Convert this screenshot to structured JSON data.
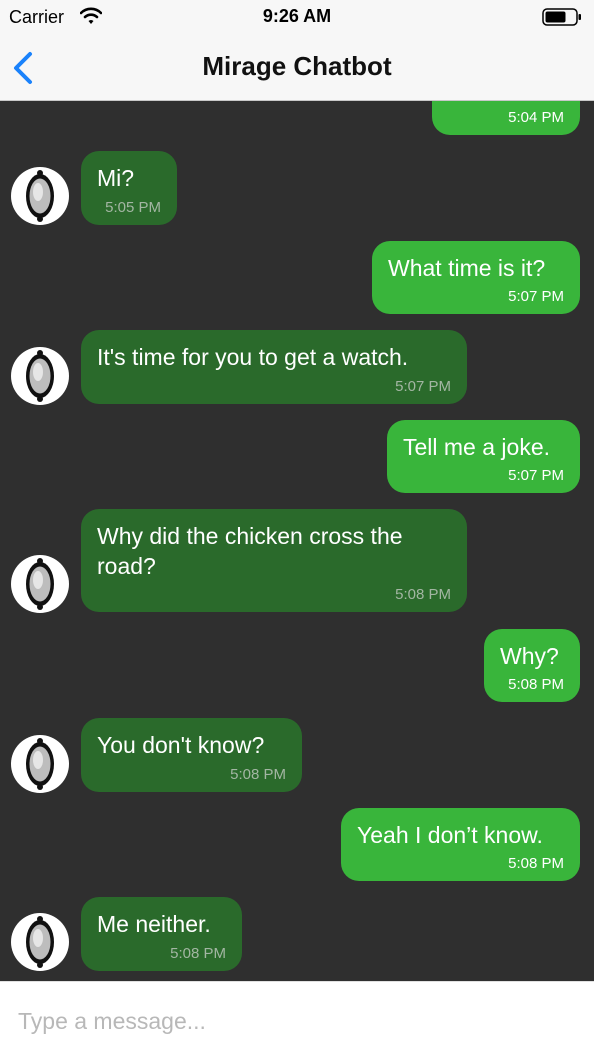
{
  "status_bar": {
    "carrier": "Carrier",
    "time": "9:26 AM"
  },
  "nav": {
    "title": "Mirage Chatbot"
  },
  "messages": [
    {
      "from": "user",
      "text": "",
      "time": "5:04 PM"
    },
    {
      "from": "bot",
      "text": "Mi?",
      "time": "5:05 PM"
    },
    {
      "from": "user",
      "text": "What time is it?",
      "time": "5:07 PM"
    },
    {
      "from": "bot",
      "text": "It's time for you to get a watch.",
      "time": "5:07 PM"
    },
    {
      "from": "user",
      "text": "Tell me a joke.",
      "time": "5:07 PM"
    },
    {
      "from": "bot",
      "text": "Why did the chicken cross the road?",
      "time": "5:08 PM"
    },
    {
      "from": "user",
      "text": "Why?",
      "time": "5:08 PM"
    },
    {
      "from": "bot",
      "text": "You don't know?",
      "time": "5:08 PM"
    },
    {
      "from": "user",
      "text": "Yeah I don’t know.",
      "time": "5:08 PM"
    },
    {
      "from": "bot",
      "text": "Me neither.",
      "time": "5:08 PM"
    }
  ],
  "composer": {
    "placeholder": "Type a message..."
  },
  "colors": {
    "accent": "#1a82fb",
    "outgoing": "#39b53b",
    "incoming": "#2a6a2b",
    "chat_bg": "#2f2f2f"
  }
}
